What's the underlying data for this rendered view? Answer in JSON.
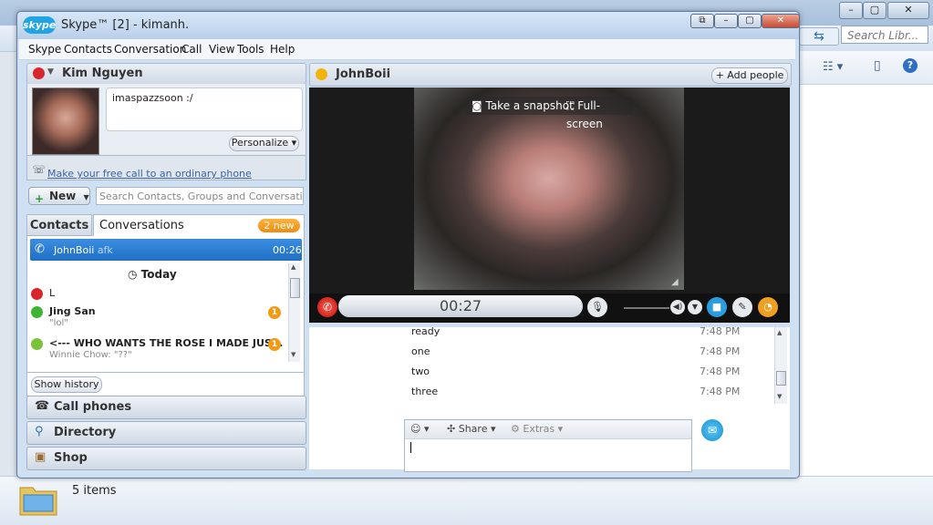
{
  "explorer": {
    "search_placeholder": "Search Libr...",
    "items_count": "5 items"
  },
  "window": {
    "title": "Skype™ [2] - kimanh.",
    "logo": "skype"
  },
  "menu": [
    "Skype",
    "Contacts",
    "Conversation",
    "Call",
    "View",
    "Tools",
    "Help"
  ],
  "profile": {
    "name": "Kim Nguyen",
    "status": "offline",
    "mood": "imaspazzsoon :/",
    "personalize_label": "Personalize ▾",
    "free_call_link": "Make your free call to an ordinary phone"
  },
  "toolbar": {
    "new_label": "New",
    "search_placeholder": "Search Contacts, Groups and Conversatio..."
  },
  "tabs": {
    "contacts": "Contacts",
    "conversations": "Conversations",
    "new_badge": "2 new"
  },
  "active_call": {
    "name": "JohnBoii",
    "status": "afk",
    "duration": "00:26"
  },
  "conversations": {
    "today_label": "Today",
    "items": [
      {
        "name": "L",
        "sub": "",
        "badge": "",
        "color": "#d8262c"
      },
      {
        "name": "Jing San",
        "sub": "\"lol\"",
        "badge": "1",
        "color": "#3cb532"
      },
      {
        "name": "<---  WHO WANTS THE ROSE I MADE JUS...",
        "sub": "Winnie Chow: \"??\"",
        "badge": "1",
        "color": "#7ac23a"
      }
    ],
    "show_history": "Show history"
  },
  "side_buttons": {
    "call_phones": "Call phones",
    "directory": "Directory",
    "shop": "Shop"
  },
  "call": {
    "contact": "JohnBoii",
    "add_people": "+ Add people",
    "snapshot": "Take a snapshot",
    "fullscreen": "Full-screen",
    "timer": "00:27"
  },
  "chat": {
    "messages": [
      {
        "text": "ready",
        "time": "7:48 PM"
      },
      {
        "text": "one",
        "time": "7:48 PM"
      },
      {
        "text": "two",
        "time": "7:48 PM"
      },
      {
        "text": "three",
        "time": "7:48 PM"
      }
    ],
    "share_label": "Share ▾",
    "extras_label": "Extras ▾"
  }
}
